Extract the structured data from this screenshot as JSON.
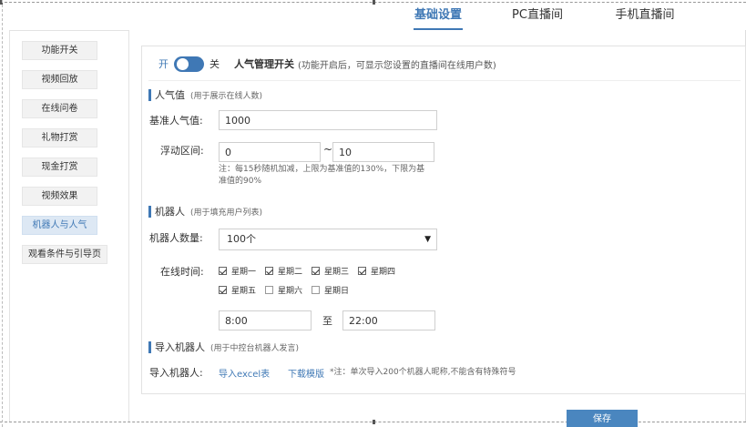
{
  "tabs": [
    {
      "label": "基础设置",
      "active": true
    },
    {
      "label": "PC直播间",
      "active": false
    },
    {
      "label": "手机直播间",
      "active": false
    }
  ],
  "sidebar": {
    "items": [
      {
        "label": "功能开关"
      },
      {
        "label": "视频回放"
      },
      {
        "label": "在线问卷"
      },
      {
        "label": "礼物打赏"
      },
      {
        "label": "现金打赏"
      },
      {
        "label": "视频效果"
      },
      {
        "label": "机器人与人气",
        "active": true
      },
      {
        "label": "观看条件与引导页"
      }
    ]
  },
  "switch": {
    "on_label": "开",
    "off_label": "关",
    "title": "人气管理开关",
    "note": "(功能开启后，可显示您设置的直播间在线用户数)",
    "enabled": true
  },
  "popularity": {
    "title": "人气值",
    "subtitle": "(用于展示在线人数)",
    "base_label": "基准人气值:",
    "base_value": "1000",
    "range_label": "浮动区间:",
    "range_min": "0",
    "range_sep": "~",
    "range_max": "10",
    "note_line1": "注：每15秒随机加减，上限为基准值的130%，下限为基",
    "note_line2": "准值的90%"
  },
  "robot": {
    "title": "机器人",
    "subtitle": "(用于填充用户列表)",
    "count_label": "机器人数量:",
    "count_value": "100个",
    "online_label": "在线时间:",
    "days": [
      {
        "label": "星期一",
        "checked": true
      },
      {
        "label": "星期二",
        "checked": true
      },
      {
        "label": "星期三",
        "checked": true
      },
      {
        "label": "星期四",
        "checked": true
      },
      {
        "label": "星期五",
        "checked": true
      },
      {
        "label": "星期六",
        "checked": false
      },
      {
        "label": "星期日",
        "checked": false
      }
    ],
    "time_start": "8:00",
    "time_sep": "至",
    "time_end": "22:00"
  },
  "import": {
    "title": "导入机器人",
    "subtitle": "(用于中控台机器人发言)",
    "label": "导入机器人:",
    "excel_link": "导入excel表",
    "template_link": "下载模版",
    "note": "*注：单次导入200个机器人昵称,不能含有特殊符号"
  },
  "save_label": "保存",
  "colors": {
    "accent": "#3f78b5",
    "button": "#4a86bf",
    "active_bg": "#dde8f4"
  }
}
